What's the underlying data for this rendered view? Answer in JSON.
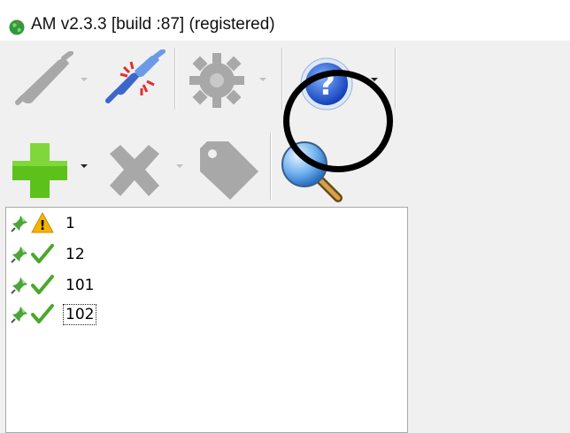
{
  "window": {
    "title": "AM v2.3.3 [build :87] (registered)",
    "app_icon": "green-globe-icon"
  },
  "toolbar_row1": {
    "buttons": [
      {
        "icon": "connect-plug-icon",
        "state": "disabled",
        "has_dropdown": true
      },
      {
        "icon": "disconnect-plug-icon",
        "state": "enabled",
        "has_dropdown": false
      },
      {
        "icon": "gear-settings-icon",
        "state": "disabled",
        "has_dropdown": true
      },
      {
        "icon": "help-question-icon",
        "state": "enabled",
        "has_dropdown": true,
        "glyph": "?"
      }
    ]
  },
  "toolbar_row2": {
    "buttons": [
      {
        "icon": "add-plus-icon",
        "state": "enabled",
        "has_dropdown": true
      },
      {
        "icon": "delete-x-icon",
        "state": "disabled",
        "has_dropdown": true
      },
      {
        "icon": "tag-label-icon",
        "state": "disabled",
        "has_dropdown": false
      },
      {
        "icon": "magnifier-search-icon",
        "state": "enabled",
        "has_dropdown": true
      }
    ]
  },
  "tree": {
    "items": [
      {
        "label": "1",
        "pin_icon": "green-pushpin-icon",
        "status_icon": "warning-triangle-icon",
        "glyph": "!"
      },
      {
        "label": "12",
        "pin_icon": "green-pushpin-icon",
        "status_icon": "checkmark-icon"
      },
      {
        "label": "101",
        "pin_icon": "green-pushpin-icon",
        "status_icon": "checkmark-icon"
      },
      {
        "label": "102",
        "pin_icon": "green-pushpin-icon",
        "status_icon": "checkmark-icon",
        "focused": true
      }
    ]
  },
  "colors": {
    "client_background": "#f0f0f0",
    "disabled_icon": "#a8a8a8",
    "add_green": "#5cc11a",
    "help_blue": "#1f5fd0",
    "check_green": "#4aa82a",
    "warning_yellow": "#f5b400",
    "annotation_circle": "#000000"
  }
}
